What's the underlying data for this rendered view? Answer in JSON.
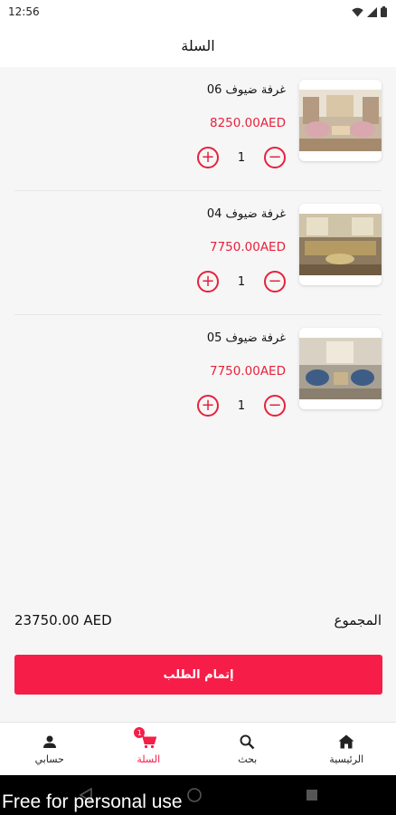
{
  "status_bar": {
    "time": "12:56"
  },
  "header": {
    "title": "السلة"
  },
  "cart": {
    "items": [
      {
        "name": "غرفة ضيوف 06",
        "price": "8250.00AED",
        "quantity": "1"
      },
      {
        "name": "غرفة ضيوف 04",
        "price": "7750.00AED",
        "quantity": "1"
      },
      {
        "name": "غرفة ضيوف 05",
        "price": "7750.00AED",
        "quantity": "1"
      }
    ]
  },
  "summary": {
    "total_label": "المجموع",
    "total_amount": "23750.00 AED"
  },
  "checkout": {
    "label": "إتمام الطلب"
  },
  "bottom_nav": {
    "cart_badge": "1",
    "items": [
      {
        "label": "حسابي",
        "icon": "person-icon"
      },
      {
        "label": "السلة",
        "icon": "cart-icon"
      },
      {
        "label": "بحث",
        "icon": "search-icon"
      },
      {
        "label": "الرئيسية",
        "icon": "home-icon"
      }
    ]
  },
  "watermark": "Free for personal use",
  "colors": {
    "accent": "#f61e48",
    "price": "#e8213b"
  }
}
